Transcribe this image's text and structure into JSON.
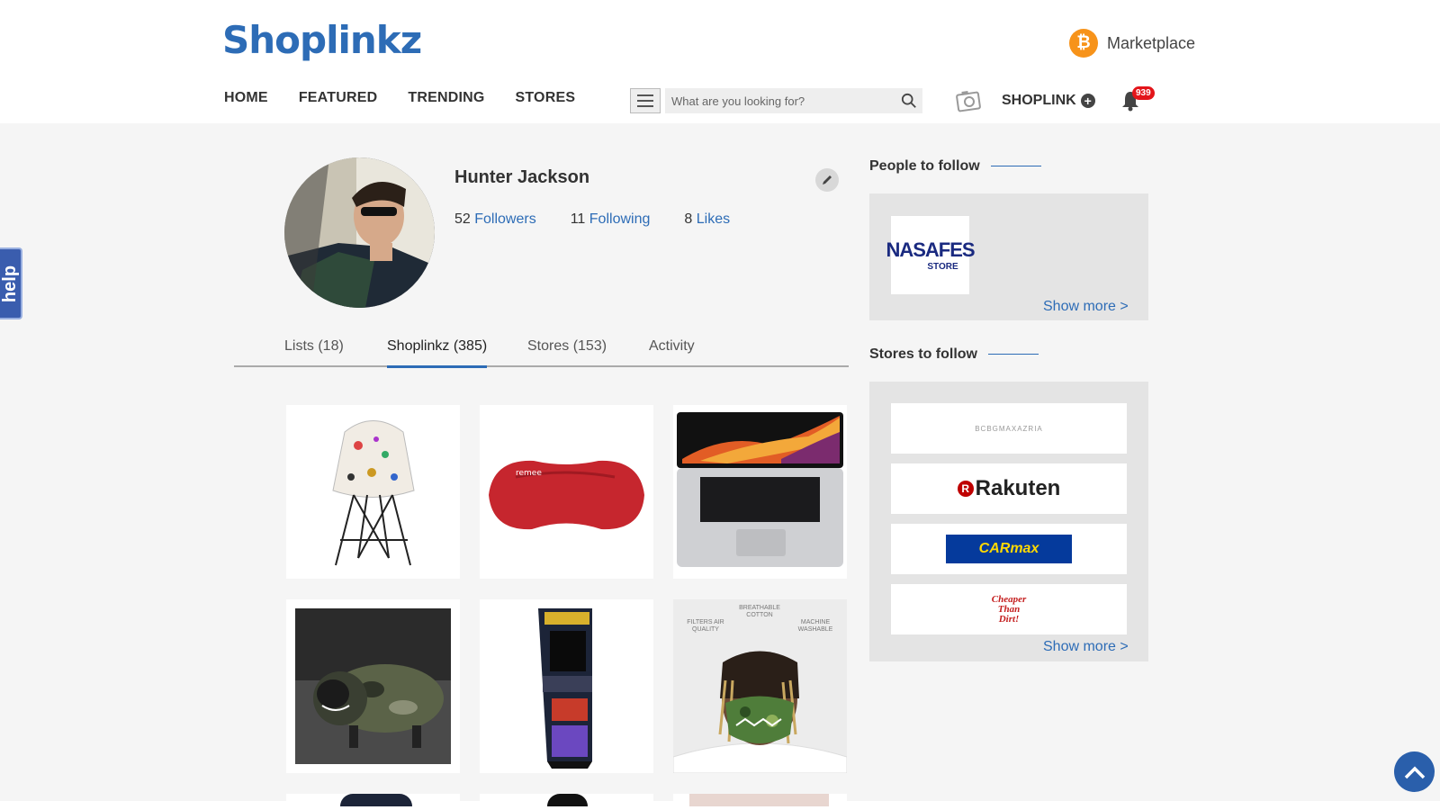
{
  "header": {
    "logo": "Shoplinkz",
    "marketplace_label": "Marketplace",
    "nav": [
      "HOME",
      "FEATURED",
      "TRENDING",
      "STORES"
    ],
    "search_placeholder": "What are you looking for?",
    "shoplink_label": "SHOPLINK",
    "notifications_count": "939"
  },
  "help_label": "help",
  "profile": {
    "name": "Hunter Jackson",
    "followers_count": "52",
    "followers_label": "Followers",
    "following_count": "11",
    "following_label": "Following",
    "likes_count": "8",
    "likes_label": "Likes"
  },
  "tabs": [
    "Lists (18)",
    "Shoplinkz (385)",
    "Stores (153)",
    "Activity"
  ],
  "active_tab": "Shoplinkz (385)",
  "products": [
    "graffiti-chair",
    "red-sleep-mask",
    "macbook-pro",
    "dog-camo-hoodie",
    "galaga-arcade-cabinet",
    "camo-face-mask"
  ],
  "mask_banner": {
    "left": "FILTERS AIR QUALITY",
    "center": "BREATHABLE COTTON",
    "right": "MACHINE WASHABLE"
  },
  "sidebar": {
    "people_title": "People to follow",
    "people": [
      {
        "name": "NASAFES",
        "sub": "STORE"
      }
    ],
    "stores_title": "Stores to follow",
    "stores": [
      "BCBGMAXAZRIA",
      "Rakuten",
      "CARmax",
      "Cheaper Than Dirt!"
    ],
    "show_more": "Show more >"
  },
  "colors": {
    "brand_blue": "#2d6cb6",
    "badge_red": "#e3151a",
    "bitcoin_orange": "#f7931a"
  }
}
